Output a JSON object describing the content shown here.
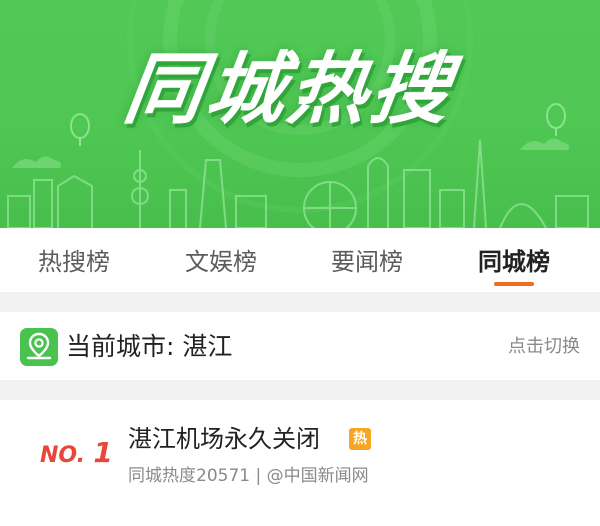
{
  "banner": {
    "title": "同城热搜",
    "bg_color": "#4fc753"
  },
  "tabs": [
    {
      "label": "热搜榜",
      "active": false
    },
    {
      "label": "文娱榜",
      "active": false
    },
    {
      "label": "要闻榜",
      "active": false
    },
    {
      "label": "同城榜",
      "active": true
    }
  ],
  "accent_color": "#f06a21",
  "city": {
    "icon": "location-pin-icon",
    "label": "当前城市: 湛江",
    "switch_label": "点击切换"
  },
  "list": [
    {
      "rank_prefix": "NO.",
      "rank": "1",
      "title": "湛江机场永久关闭",
      "tag": "热",
      "meta": "同城热度20571 | @中国新闻网"
    }
  ]
}
